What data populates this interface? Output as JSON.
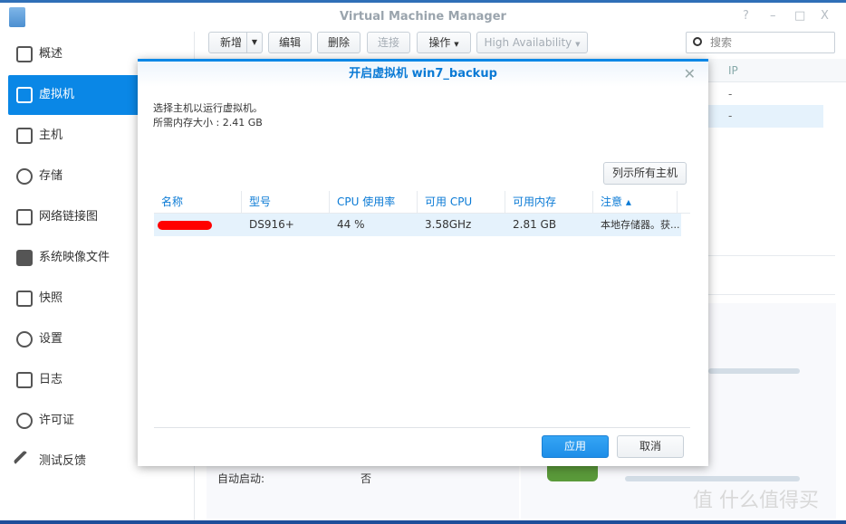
{
  "window": {
    "title": "Virtual Machine Manager",
    "controls": [
      "?",
      "–",
      "□",
      "X"
    ]
  },
  "sidebar": {
    "items": [
      {
        "label": "概述",
        "icon": "overview-icon"
      },
      {
        "label": "虚拟机",
        "icon": "vm-icon",
        "selected": true
      },
      {
        "label": "主机",
        "icon": "host-icon"
      },
      {
        "label": "存储",
        "icon": "storage-icon"
      },
      {
        "label": "网络链接图",
        "icon": "network-icon"
      },
      {
        "label": "系统映像文件",
        "icon": "dsm-image-icon"
      },
      {
        "label": "快照",
        "icon": "snapshot-icon"
      },
      {
        "label": "设置",
        "icon": "gear-icon"
      },
      {
        "label": "日志",
        "icon": "log-icon"
      },
      {
        "label": "许可证",
        "icon": "key-icon"
      },
      {
        "label": "测试反馈",
        "icon": "wrench-icon"
      }
    ]
  },
  "toolbar": {
    "new": "新增",
    "edit": "编辑",
    "delete": "删除",
    "connect": "连接",
    "action": "操作",
    "ha": "High Availability",
    "search_placeholder": "搜索"
  },
  "background": {
    "ip_header": "IP",
    "ip_values": [
      "-",
      "-"
    ],
    "autostart_label": "自动启动:",
    "autostart_value": "否"
  },
  "dialog": {
    "title": "开启虚拟机 win7_backup",
    "instruction": "选择主机以运行虚拟机。",
    "memory_required": "所需内存大小 : 2.41 GB",
    "list_all_button": "列示所有主机",
    "columns": [
      "名称",
      "型号",
      "CPU 使用率",
      "可用 CPU",
      "可用内存",
      "注意 ▴"
    ],
    "rows": [
      {
        "name": "",
        "model": "DS916+",
        "cpu_usage": "44 %",
        "cpu_available": "3.58GHz",
        "mem_available": "2.81 GB",
        "note": "本地存储器。获..."
      }
    ],
    "apply": "应用",
    "cancel": "取消"
  },
  "watermark": "值 什么值得买",
  "colors": {
    "accent": "#0a87e6",
    "title_blue": "#0a7ad5"
  }
}
